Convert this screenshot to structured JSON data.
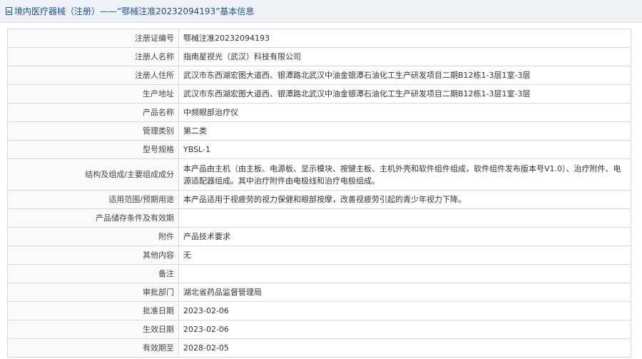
{
  "header": {
    "title": "境内医疗器械（注册）——“鄂械注准20232094193”基本信息"
  },
  "rows": [
    {
      "label": "注册证编号",
      "value": "鄂械注准20232094193"
    },
    {
      "label": "注册人名称",
      "value": "指南星视光（武汉）科技有限公司"
    },
    {
      "label": "注册人住所",
      "value": "武汉市东西湖宏图大道西、银潭路北武汉中油金银潭石油化工生产研发项目二期B12栋1-3层1室-3层"
    },
    {
      "label": "生产地址",
      "value": "武汉市东西湖宏图大道西、银潭路北武汉中油金银潭石油化工生产研发项目二期B12栋1-3层1室-3层"
    },
    {
      "label": "产品名称",
      "value": "中频眼部治疗仪"
    },
    {
      "label": "管理类别",
      "value": "第二类"
    },
    {
      "label": "型号规格",
      "value": "YBSL-1"
    },
    {
      "label": "结构及组成/主要组成成分",
      "value": "本产品由主机（由主板、电源板、显示模块、按键主板、主机外壳和软件组件组成，软件组件发布版本号V1.0）、治疗附件、电源适配器组成。其中治疗附件由电极线和治疗电极组成。"
    },
    {
      "label": "适用范围/预期用途",
      "value": "本产品适用于视疲劳的视力保健和眼部按摩，改善视疲劳引起的青少年视力下降。"
    },
    {
      "label": "产品储存条件及有效期",
      "value": ""
    },
    {
      "label": "附件",
      "value": "产品技术要求"
    },
    {
      "label": "其他内容",
      "value": "无"
    },
    {
      "label": "备注",
      "value": ""
    },
    {
      "label": "审批部门",
      "value": "湖北省药品监督管理局"
    },
    {
      "label": "批准日期",
      "value": "2023-02-06"
    },
    {
      "label": "生效日期",
      "value": "2023-02-06"
    },
    {
      "label": "有效期至",
      "value": "2028-02-05"
    }
  ]
}
